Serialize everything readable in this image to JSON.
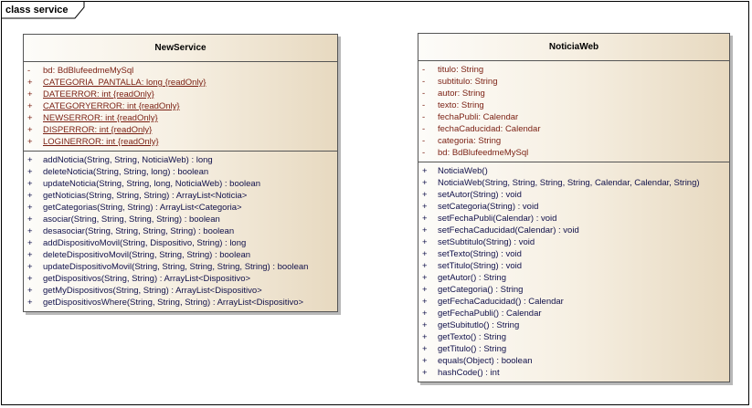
{
  "diagram": {
    "frame_title": "class service",
    "classes": [
      {
        "name": "NewService",
        "attributes": [
          {
            "visibility": "-",
            "text": "bd:  BdBlufeedmeMySql",
            "static": false
          },
          {
            "visibility": "+",
            "text": "CATEGORIA_PANTALLA:  long {readOnly}",
            "static": true
          },
          {
            "visibility": "+",
            "text": "DATEERROR:  int {readOnly}",
            "static": true
          },
          {
            "visibility": "+",
            "text": "CATEGORYERROR:  int {readOnly}",
            "static": true
          },
          {
            "visibility": "+",
            "text": "NEWSERROR:  int {readOnly}",
            "static": true
          },
          {
            "visibility": "+",
            "text": "DISPERROR:  int {readOnly}",
            "static": true
          },
          {
            "visibility": "+",
            "text": "LOGINERROR:  int {readOnly}",
            "static": true
          }
        ],
        "operations": [
          {
            "visibility": "+",
            "text": "addNoticia(String, String, NoticiaWeb) : long"
          },
          {
            "visibility": "+",
            "text": "deleteNoticia(String, String, long) : boolean"
          },
          {
            "visibility": "+",
            "text": "updateNoticia(String, String, long, NoticiaWeb) : boolean"
          },
          {
            "visibility": "+",
            "text": "getNoticias(String, String, String) : ArrayList<Noticia>"
          },
          {
            "visibility": "+",
            "text": "getCategorias(String, String) : ArrayList<Categoria>"
          },
          {
            "visibility": "+",
            "text": "asociar(String, String, String, String) : boolean"
          },
          {
            "visibility": "+",
            "text": "desasociar(String, String, String, String) : boolean"
          },
          {
            "visibility": "+",
            "text": "addDispositivoMovil(String, Dispositivo, String) : long"
          },
          {
            "visibility": "+",
            "text": "deleteDispositivoMovil(String, String, String) : boolean"
          },
          {
            "visibility": "+",
            "text": "updateDispositivoMovil(String, String, String, String, String) : boolean"
          },
          {
            "visibility": "+",
            "text": "getDispositivos(String, String) : ArrayList<Dispositivo>"
          },
          {
            "visibility": "+",
            "text": "getMyDispositivos(String, String) : ArrayList<Dispositivo>"
          },
          {
            "visibility": "+",
            "text": "getDispositivosWhere(String, String, String) : ArrayList<Dispositivo>"
          }
        ]
      },
      {
        "name": "NoticiaWeb",
        "attributes": [
          {
            "visibility": "-",
            "text": "titulo:  String",
            "static": false
          },
          {
            "visibility": "-",
            "text": "subtitulo:  String",
            "static": false
          },
          {
            "visibility": "-",
            "text": "autor:  String",
            "static": false
          },
          {
            "visibility": "-",
            "text": "texto:  String",
            "static": false
          },
          {
            "visibility": "-",
            "text": "fechaPubli:  Calendar",
            "static": false
          },
          {
            "visibility": "-",
            "text": "fechaCaducidad:  Calendar",
            "static": false
          },
          {
            "visibility": "-",
            "text": "categoria:  String",
            "static": false
          },
          {
            "visibility": "-",
            "text": "bd:  BdBlufeedmeMySql",
            "static": false
          }
        ],
        "operations": [
          {
            "visibility": "+",
            "text": "NoticiaWeb()"
          },
          {
            "visibility": "+",
            "text": "NoticiaWeb(String, String, String, String, Calendar, Calendar, String)"
          },
          {
            "visibility": "+",
            "text": "setAutor(String) : void"
          },
          {
            "visibility": "+",
            "text": "setCategoria(String) : void"
          },
          {
            "visibility": "+",
            "text": "setFechaPubli(Calendar) : void"
          },
          {
            "visibility": "+",
            "text": "setFechaCaducidad(Calendar) : void"
          },
          {
            "visibility": "+",
            "text": "setSubtitulo(String) : void"
          },
          {
            "visibility": "+",
            "text": "setTexto(String) : void"
          },
          {
            "visibility": "+",
            "text": "setTitulo(String) : void"
          },
          {
            "visibility": "+",
            "text": "getAutor() : String"
          },
          {
            "visibility": "+",
            "text": "getCategoria() : String"
          },
          {
            "visibility": "+",
            "text": "getFechaCaducidad() : Calendar"
          },
          {
            "visibility": "+",
            "text": "getFechaPubli() : Calendar"
          },
          {
            "visibility": "+",
            "text": " getSubitutlo() : String"
          },
          {
            "visibility": "+",
            "text": "getTexto() : String"
          },
          {
            "visibility": "+",
            "text": "getTitulo() : String"
          },
          {
            "visibility": "+",
            "text": "equals(Object) : boolean"
          },
          {
            "visibility": "+",
            "text": "hashCode() : int"
          }
        ]
      }
    ]
  }
}
